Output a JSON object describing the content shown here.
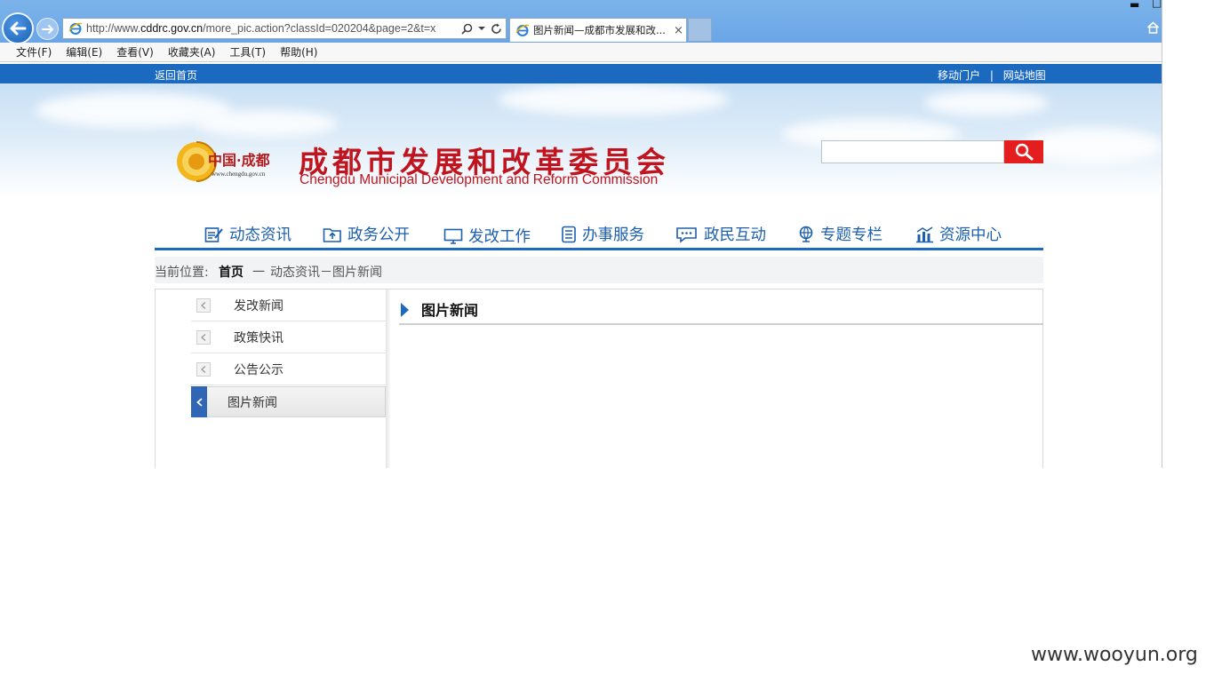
{
  "browser": {
    "url_prefix": "http://www.",
    "url_domain": "cddrc.gov.cn",
    "url_rest": "/more_pic.action?classId=020204&page=2&t=x",
    "tab_title": "图片新闻—成都市发展和改...",
    "tab_close": "×",
    "minimize": "▬",
    "maximize": "□"
  },
  "menubar": {
    "items": [
      "文件(F)",
      "编辑(E)",
      "查看(V)",
      "收藏夹(A)",
      "工具(T)",
      "帮助(H)"
    ]
  },
  "topstrip": {
    "home_link": "返回首页",
    "mobile_portal": "移动门户",
    "separator": "|",
    "site_map": "网站地图"
  },
  "header": {
    "logo_text": "中国·成都",
    "logo_url": "www.chengdu.gov.cn",
    "site_name_cn": "成都市发展和改革委员会",
    "site_name_en": "Chengdu Municipal Development and Reform Commission",
    "search_placeholder": ""
  },
  "nav": {
    "items": [
      "动态资讯",
      "政务公开",
      "发改工作",
      "办事服务",
      "政民互动",
      "专题专栏",
      "资源中心"
    ]
  },
  "breadcrumb": {
    "label": "当前位置:",
    "home": "首页",
    "sep": "一",
    "path": "动态资讯－图片新闻"
  },
  "sidebar": {
    "items": [
      "发改新闻",
      "政策快讯",
      "公告公示",
      "图片新闻"
    ],
    "active": "图片新闻"
  },
  "panel": {
    "title": "图片新闻"
  },
  "watermark": "www.wooyun.org",
  "colors": {
    "brand_blue": "#1c6ac0",
    "brand_red": "#c0141e",
    "search_red": "#e41e1e"
  }
}
